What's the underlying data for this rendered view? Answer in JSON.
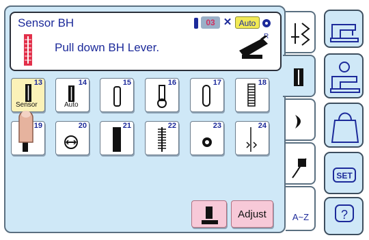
{
  "panel": {
    "title": "Sensor BH",
    "message": "Pull down BH Lever.",
    "status": {
      "tension": "03",
      "auto": "Auto",
      "foot_code": "R"
    }
  },
  "stitches": [
    {
      "number": "13",
      "label": "Sensor",
      "selected": true,
      "icon": "sensor-buttonhole-icon"
    },
    {
      "number": "14",
      "label": "Auto",
      "selected": false,
      "icon": "auto-buttonhole-icon"
    },
    {
      "number": "15",
      "label": "",
      "selected": false,
      "icon": "round-buttonhole-icon"
    },
    {
      "number": "16",
      "label": "",
      "selected": false,
      "icon": "keyhole-buttonhole-icon"
    },
    {
      "number": "17",
      "label": "",
      "selected": false,
      "icon": "rounded-buttonhole-icon"
    },
    {
      "number": "18",
      "label": "",
      "selected": false,
      "icon": "stretch-buttonhole-icon"
    },
    {
      "number": "19",
      "label": "",
      "selected": false,
      "icon": "bound-buttonhole-icon"
    },
    {
      "number": "20",
      "label": "",
      "selected": false,
      "icon": "button-sewing-icon"
    },
    {
      "number": "21",
      "label": "",
      "selected": false,
      "icon": "dense-buttonhole-icon"
    },
    {
      "number": "22",
      "label": "",
      "selected": false,
      "icon": "zigzag-buttonhole-icon"
    },
    {
      "number": "23",
      "label": "",
      "selected": false,
      "icon": "eyelet-icon"
    },
    {
      "number": "24",
      "label": "",
      "selected": false,
      "icon": "darning-icon"
    }
  ],
  "bottom_buttons": {
    "adjust": "Adjust"
  },
  "tabs": {
    "az": "A~Z"
  },
  "side_buttons": {
    "set": "SET",
    "help": "?"
  }
}
